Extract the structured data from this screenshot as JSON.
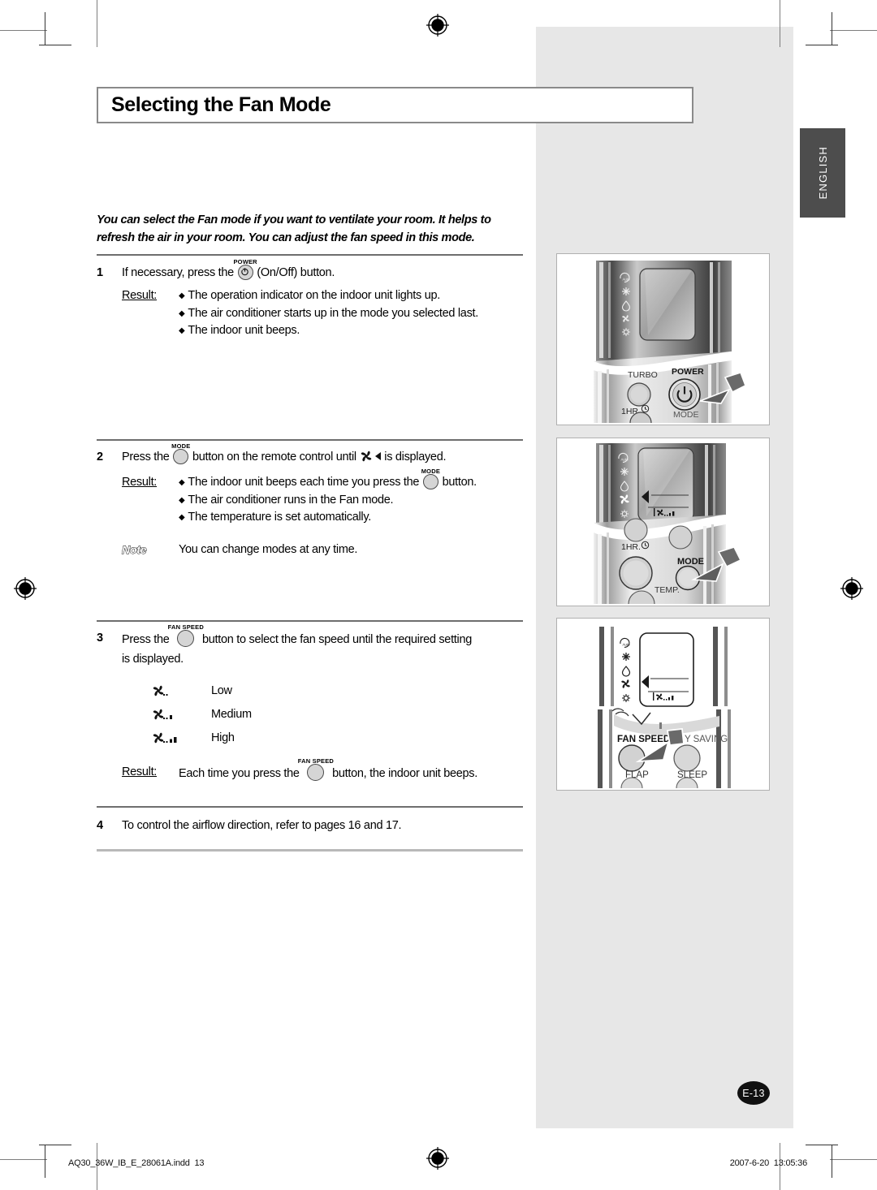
{
  "document": {
    "title": "Selecting the Fan Mode",
    "language_tab": "ENGLISH",
    "page_badge": "E-13",
    "intro": "You can select the Fan mode if you want to ventilate your room. It helps to refresh the air in your room. You can adjust the fan speed in this mode.",
    "result_label": "Result:",
    "note_label": "Note"
  },
  "steps": {
    "s1": {
      "num": "1",
      "text_before": "If necessary, press the",
      "button_caption": "POWER",
      "button_icon": "power-icon",
      "text_after": "(On/Off) button.",
      "results": [
        "The operation indicator on the indoor unit lights up.",
        "The air conditioner starts up in the mode you selected last.",
        "The indoor unit beeps."
      ]
    },
    "s2": {
      "num": "2",
      "text_before": "Press the",
      "button_caption": "MODE",
      "text_mid": "button on the remote control until",
      "display_icon": "fan-with-left-arrow-icon",
      "text_after": "is displayed.",
      "result_before": "The indoor unit beeps each time you press the",
      "result_button_caption": "MODE",
      "result_after": "button.",
      "results_rest": [
        "The air conditioner runs in the Fan mode.",
        "The temperature is set automatically."
      ],
      "note_text": "You can change modes at any time."
    },
    "s3": {
      "num": "3",
      "text_before": "Press the",
      "button_caption": "FAN SPEED",
      "text_after": "button to select the fan speed until the required setting",
      "text_line2": "is displayed.",
      "speeds": [
        {
          "icon": "fan-speed-low-icon",
          "bars": 0,
          "label": "Low"
        },
        {
          "icon": "fan-speed-medium-icon",
          "bars": 1,
          "label": "Medium"
        },
        {
          "icon": "fan-speed-high-icon",
          "bars": 2,
          "label": "High"
        }
      ],
      "result_before": "Each time you press the",
      "result_button_caption": "FAN SPEED",
      "result_after": "button, the indoor unit beeps."
    },
    "s4": {
      "num": "4",
      "text": "To control the airflow direction, refer to pages 16 and 17."
    }
  },
  "illustrations": [
    {
      "name": "remote-power-button",
      "mode_icons": [
        "auto-icon",
        "snowflake-icon",
        "water-drop-icon",
        "fan-icon",
        "sun-icon"
      ],
      "labels": [
        "TURBO",
        "POWER",
        "1HR.",
        "MODE"
      ],
      "highlighted_button": "POWER"
    },
    {
      "name": "remote-mode-button",
      "mode_icons": [
        "auto-icon",
        "snowflake-icon",
        "water-drop-icon",
        "fan-icon",
        "sun-icon"
      ],
      "labels": [
        "1HR.",
        "MODE",
        "TEMP."
      ],
      "highlighted_button": "MODE",
      "display_shows": "fan-mode-selected"
    },
    {
      "name": "remote-fan-speed-button",
      "mode_icons": [
        "auto-icon",
        "snowflake-icon",
        "water-drop-icon",
        "fan-icon",
        "sun-icon"
      ],
      "labels": [
        "FAN SPEED",
        "GY SAVING",
        "FLAP",
        "SLEEP"
      ],
      "highlighted_button": "FAN SPEED",
      "display_shows": "fan-speed-bars"
    }
  ],
  "footer": {
    "file_name": "AQ30_36W_IB_E_28061A.indd",
    "page_number": "13",
    "timestamp_date": "2007-6-20",
    "timestamp_time": "13:05:36"
  },
  "colors": {
    "panel_gray": "#e7e7e7",
    "tab_gray": "#4d4d4d",
    "rule_gray": "#6e6e6e",
    "title_border": "#8a8a8a"
  }
}
